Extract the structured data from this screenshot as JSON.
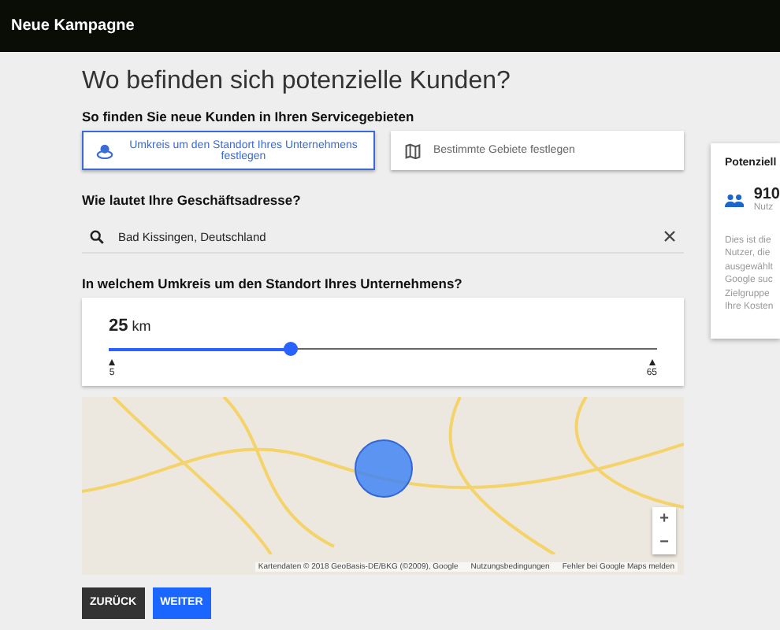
{
  "header": {
    "title": "Neue Kampagne"
  },
  "page_title": "Wo befinden sich potenzielle Kunden?",
  "service_area": {
    "label": "So finden Sie neue Kunden in Ihren Servicegebieten",
    "options": [
      {
        "kind": "radius",
        "label": "Umkreis um den Standort Ihres Unternehmens festlegen",
        "selected": true
      },
      {
        "kind": "regions",
        "label": "Bestimmte Gebiete festlegen",
        "selected": false
      }
    ]
  },
  "address": {
    "label": "Wie lautet Ihre Geschäftsadresse?",
    "value": "Bad Kissingen, Deutschland"
  },
  "radius": {
    "label": "In welchem Umkreis um den Standort Ihres Unternehmens?",
    "value": "25",
    "unit": "km",
    "level": 0.333,
    "min": "5",
    "max": "65"
  },
  "map": {
    "attribution": "Kartendaten © 2018 GeoBasis-DE/BKG (©2009), Google",
    "terms": "Nutzungsbedingungen",
    "report": "Fehler bei Google Maps melden",
    "zoom_in": "+",
    "zoom_out": "−"
  },
  "buttons": [
    {
      "kind": "back",
      "label": "ZURÜCK"
    },
    {
      "kind": "next",
      "label": "WEITER"
    }
  ],
  "side_card": {
    "title": "Potenziell",
    "count": "910",
    "count_label": "Nutz",
    "lines": [
      "Dies ist die",
      "Nutzer, die",
      "ausgewählt",
      "Google suc",
      "Zielgruppe",
      "Ihre Kosten"
    ]
  }
}
